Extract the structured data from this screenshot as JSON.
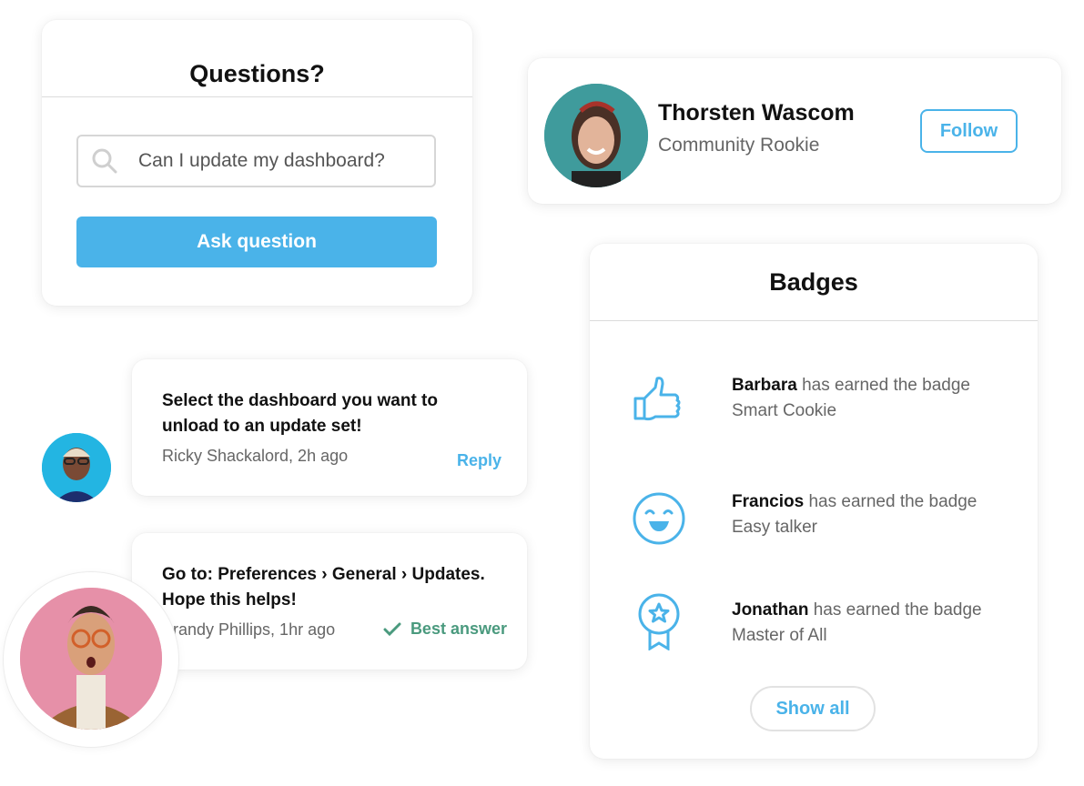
{
  "questions": {
    "title": "Questions?",
    "search_value": "Can I update my dashboard?",
    "search_icon": "search-icon",
    "ask_button": "Ask question"
  },
  "profile": {
    "name": "Thorsten Wascom",
    "role": "Community Rookie",
    "follow_button": "Follow"
  },
  "comments": [
    {
      "text": "Select the dashboard you want to unload to an update set!",
      "meta": "Ricky Shackalord, 2h ago",
      "action": "Reply"
    },
    {
      "text": "Go to: Preferences › General › Updates. Hope this helps!",
      "meta": "Brandy Phillips, 1hr ago",
      "status": "Best answer",
      "status_icon": "check-icon"
    }
  ],
  "badges": {
    "title": "Badges",
    "items": [
      {
        "user": "Barbara",
        "text_middle": " has earned the badge ",
        "badge": "Smart Cookie",
        "icon": "thumbs-up-icon"
      },
      {
        "user": "Francios",
        "text_middle": " has earned the badge ",
        "badge": "Easy talker",
        "icon": "smiley-icon"
      },
      {
        "user": "Jonathan",
        "text_middle": " has earned the badge ",
        "badge": "Master of All",
        "icon": "award-ribbon-icon"
      }
    ],
    "show_all": "Show all"
  },
  "colors": {
    "accent": "#4ab3e9",
    "success": "#4a9a7e",
    "text_primary": "#111111",
    "text_secondary": "#666666"
  }
}
